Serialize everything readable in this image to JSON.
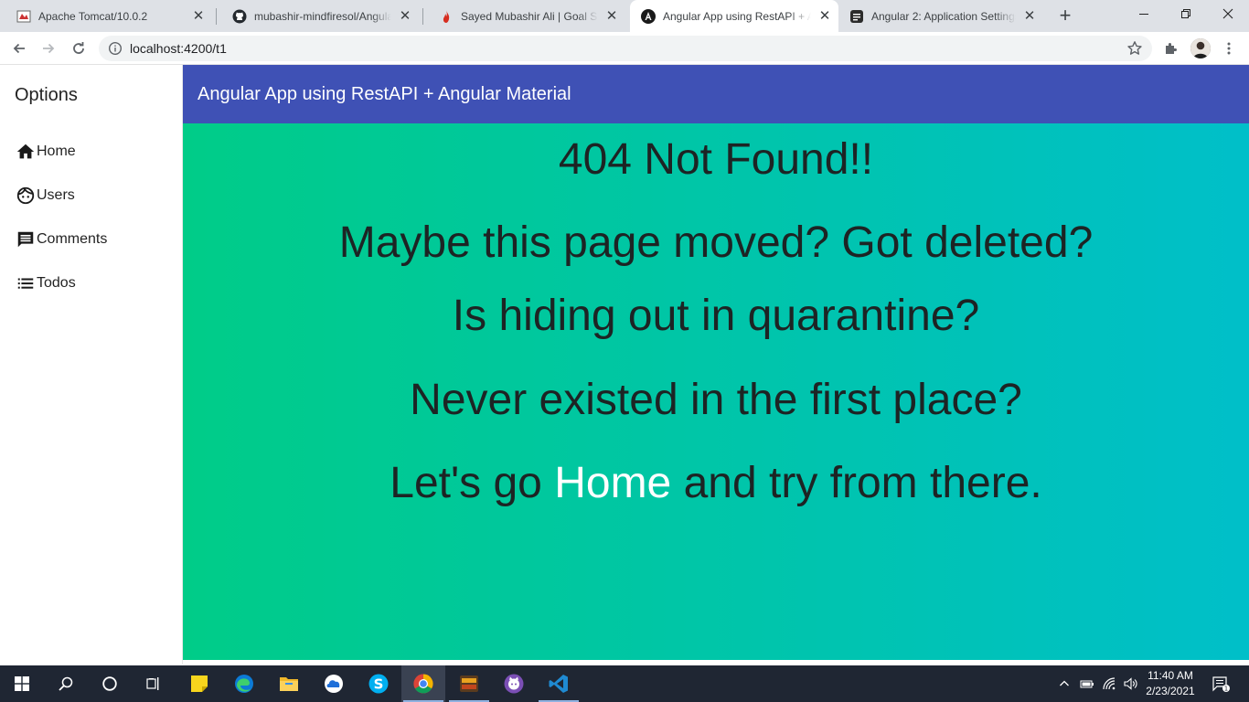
{
  "browser": {
    "tabs": [
      {
        "title": "Apache Tomcat/10.0.2",
        "icon": "tomcat-favicon",
        "active": false
      },
      {
        "title": "mubashir-mindfiresol/Angular",
        "icon": "github-favicon",
        "active": false
      },
      {
        "title": "Sayed Mubashir Ali | Goal Shee",
        "icon": "flame-favicon",
        "active": false
      },
      {
        "title": "Angular App using RestAPI + A",
        "icon": "angular-favicon",
        "active": true
      },
      {
        "title": "Angular 2: Application Settings",
        "icon": "document-favicon",
        "active": false
      }
    ],
    "url": "localhost:4200/t1"
  },
  "sidebar": {
    "title": "Options",
    "items": [
      {
        "label": "Home",
        "icon": "home-icon"
      },
      {
        "label": "Users",
        "icon": "face-icon"
      },
      {
        "label": "Comments",
        "icon": "comment-icon"
      },
      {
        "label": "Todos",
        "icon": "list-icon"
      }
    ]
  },
  "header": {
    "title": "Angular App using RestAPI + Angular Material"
  },
  "content": {
    "heading": "404 Not Found!!",
    "line1": "Maybe this page moved? Got deleted?",
    "line2": "Is hiding out in quarantine?",
    "line3": "Never existed in the first place?",
    "line4_before": "Let's go ",
    "line4_link": "Home",
    "line4_after": " and try from there."
  },
  "taskbar": {
    "time": "11:40 AM",
    "date": "2/23/2021",
    "notification_count": "1"
  },
  "colors": {
    "header_bg": "#3f51b5",
    "gradient_start": "#00cc88",
    "gradient_end": "#00bfc9",
    "taskbar_bg": "#1f2633"
  }
}
